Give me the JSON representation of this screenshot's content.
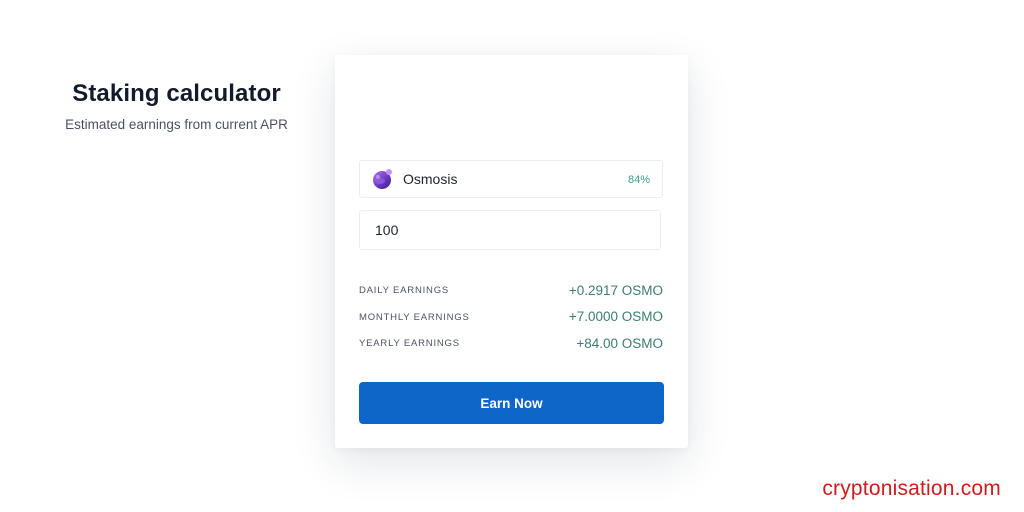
{
  "calculator": {
    "title": "Staking calculator",
    "subtitle": "Estimated earnings from current APR"
  },
  "asset": {
    "icon": "osmosis-logo-icon",
    "name": "Osmosis",
    "apr": "84%"
  },
  "amount": {
    "value": "100"
  },
  "earnings": [
    {
      "label": "DAILY EARNINGS",
      "value": "+0.2917 OSMO"
    },
    {
      "label": "MONTHLY EARNINGS",
      "value": "+7.0000 OSMO"
    },
    {
      "label": "YEARLY EARNINGS",
      "value": "+84.00 OSMO"
    }
  ],
  "actions": {
    "earn_label": "Earn Now"
  },
  "watermark": {
    "text": "cryptonisation.com"
  },
  "colors": {
    "primary_button": "#0d66c8",
    "earnings_value": "#3b7d70",
    "apr_value": "#3a9d8a",
    "watermark": "#cc1c1c"
  }
}
